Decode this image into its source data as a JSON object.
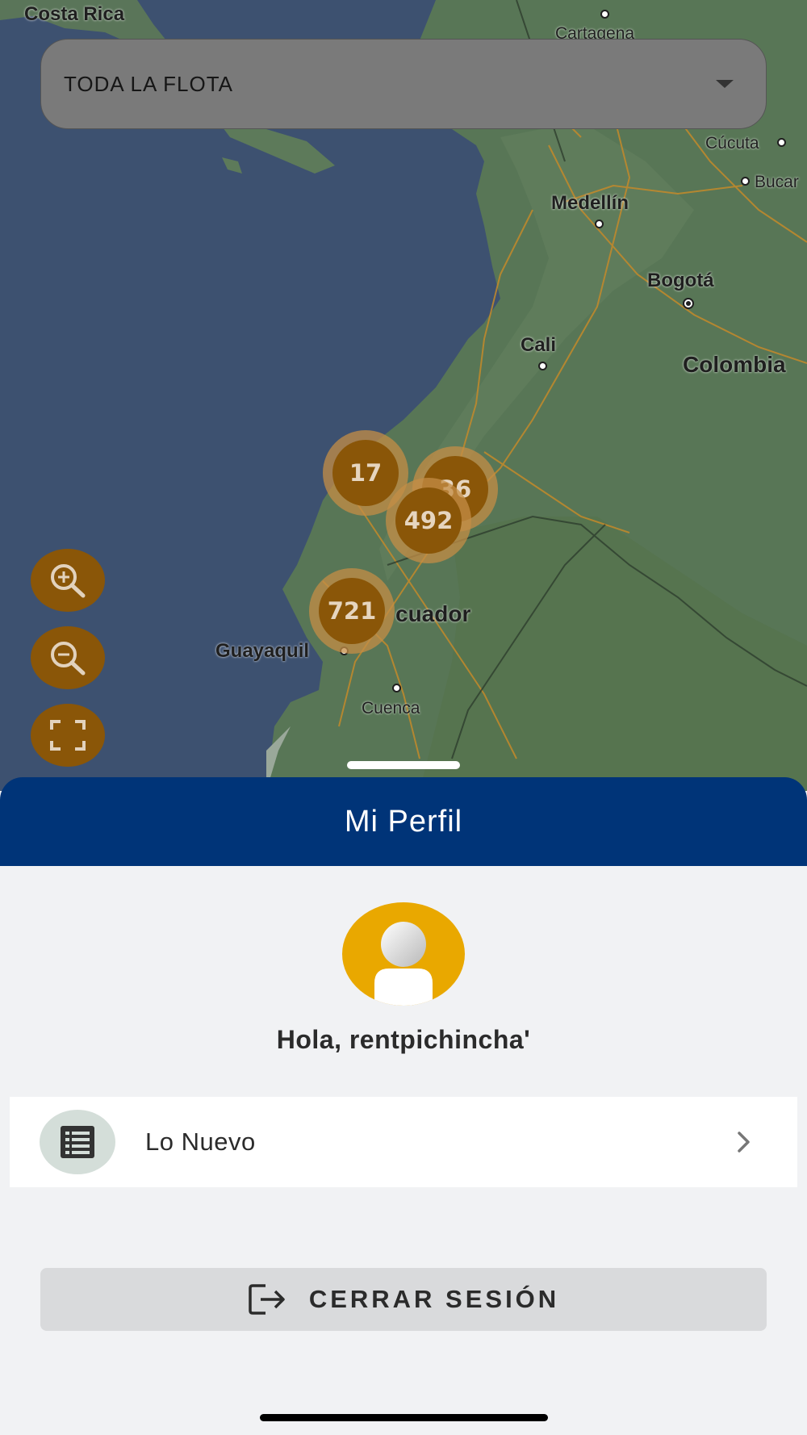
{
  "map": {
    "places": [
      {
        "name": "Costa Rica"
      },
      {
        "name": "Cartagena"
      },
      {
        "name": "Cúcuta"
      },
      {
        "name": "Bucar"
      },
      {
        "name": "Medellín"
      },
      {
        "name": "Bogotá"
      },
      {
        "name": "Cali"
      },
      {
        "name": "Colombia"
      },
      {
        "name": "cuador"
      },
      {
        "name": "Guayaquil"
      },
      {
        "name": "Cuenca"
      }
    ],
    "clusters": [
      {
        "count": "17"
      },
      {
        "count": "36"
      },
      {
        "count": "492"
      },
      {
        "count": "721"
      }
    ],
    "controls": {
      "zoom_in": "zoom-in-icon",
      "zoom_out": "zoom-out-icon",
      "fullscreen": "fullscreen-icon"
    }
  },
  "fleet_select": {
    "value": "TODA LA FLOTA"
  },
  "sheet": {
    "title": "Mi Perfil",
    "greeting": "Hola, rentpichincha'",
    "menu": [
      {
        "label": "Lo Nuevo",
        "icon": "list-icon"
      }
    ],
    "logout_label": "CERRAR SESIÓN"
  },
  "colors": {
    "header": "#003478",
    "accent": "#e9a800",
    "cluster": "#8a5608"
  }
}
